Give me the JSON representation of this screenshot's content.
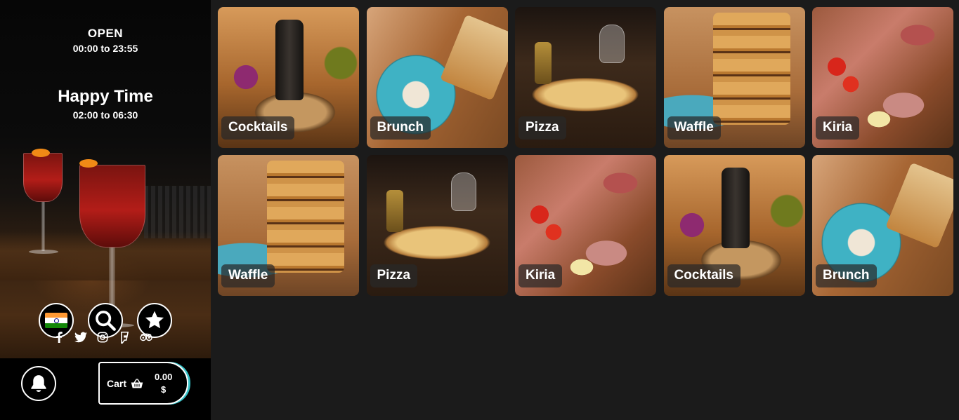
{
  "sidebar": {
    "hours": {
      "title": "OPEN",
      "range": "00:00 to 23:55"
    },
    "happy_time": {
      "title": "Happy Time",
      "range": "02:00 to 06:30"
    },
    "buttons": {
      "language": "india-flag-icon",
      "search": "search-icon",
      "favorites": "star-icon"
    },
    "socials": [
      "facebook-icon",
      "twitter-icon",
      "instagram-icon",
      "foursquare-icon",
      "tripadvisor-icon"
    ],
    "notifications": "bell-icon",
    "cart": {
      "label": "Cart",
      "amount": "0.00",
      "currency": "$"
    }
  },
  "colors": {
    "cart_accent": "#37c3c9",
    "background": "#1b1b1b",
    "sidebar": "#000000"
  },
  "categories": [
    {
      "label": "Cocktails",
      "art": "cocktails"
    },
    {
      "label": "Brunch",
      "art": "brunch"
    },
    {
      "label": "Pizza",
      "art": "pizza"
    },
    {
      "label": "Waffle",
      "art": "waffle"
    },
    {
      "label": "Kiria",
      "art": "kiria"
    },
    {
      "label": "Waffle",
      "art": "waffle"
    },
    {
      "label": "Pizza",
      "art": "pizza"
    },
    {
      "label": "Kiria",
      "art": "kiria"
    },
    {
      "label": "Cocktails",
      "art": "cocktails"
    },
    {
      "label": "Brunch",
      "art": "brunch"
    }
  ]
}
